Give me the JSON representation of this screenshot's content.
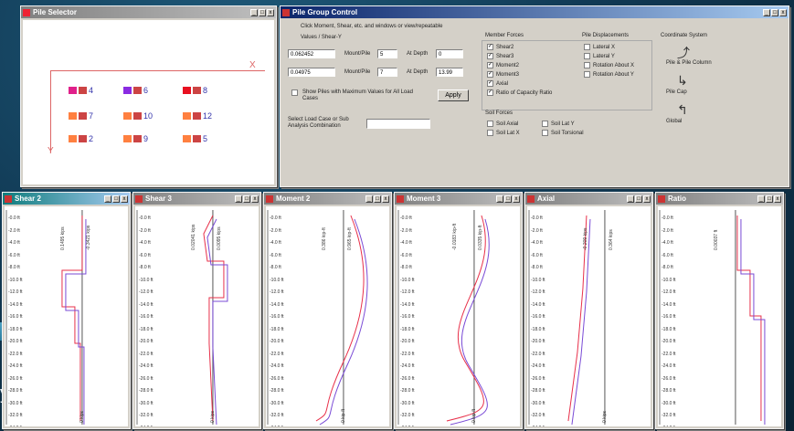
{
  "slide": {
    "text": "y"
  },
  "pile_selector": {
    "title": "Pile Selector",
    "axis_x": "X",
    "axis_y": "Y",
    "piles": [
      {
        "label": "4",
        "color": "#e0208a"
      },
      {
        "label": "6",
        "color": "#8a2be2"
      },
      {
        "label": "8",
        "color": "#e81020"
      },
      {
        "label": "7",
        "color": "#ff8040"
      },
      {
        "label": "10",
        "color": "#ff8040"
      },
      {
        "label": "12",
        "color": "#ff8040"
      },
      {
        "label": "2",
        "color": "#ff8040"
      },
      {
        "label": "9",
        "color": "#ff8040"
      },
      {
        "label": "5",
        "color": "#ff8040"
      }
    ]
  },
  "pile_group_control": {
    "title": "Pile Group Control",
    "instruction": "Click Moment, Shear, etc. and windows or view/repeatable",
    "values_label": "Values / Shear-Y",
    "value_1": "0.062452",
    "value_2": "0.04975",
    "at_pile_label": "Mount/Pile",
    "at_pile_1": "5",
    "at_pile_2": "7",
    "at_depth_label": "At Depth",
    "at_depth_1": "0",
    "at_depth_2": "13.99",
    "show_piles_label": "Show Piles with Maximum Values for All Load Cases",
    "apply_label": "Apply",
    "select_load_label": "Select Load Case or Sub Analysis Combination",
    "member_forces_title": "Member Forces",
    "member_forces": [
      {
        "label": "Shear2",
        "checked": true
      },
      {
        "label": "Shear3",
        "checked": true
      },
      {
        "label": "Moment2",
        "checked": true
      },
      {
        "label": "Moment3",
        "checked": true
      },
      {
        "label": "Axial",
        "checked": true
      },
      {
        "label": "Ratio of Capacity Ratio",
        "checked": true
      }
    ],
    "soil_forces_title": "Soil Forces",
    "soil_forces": [
      {
        "label": "Soil Axial",
        "checked": false
      },
      {
        "label": "Soil Lat X",
        "checked": false
      },
      {
        "label": "Soil Lat Y",
        "checked": false
      },
      {
        "label": "Soil Torsional",
        "checked": false
      }
    ],
    "pile_displacements_title": "Pile Displacements",
    "pile_displacements": [
      {
        "label": "Lateral X",
        "checked": false
      },
      {
        "label": "Lateral Y",
        "checked": false
      },
      {
        "label": "Rotation About X",
        "checked": false
      },
      {
        "label": "Rotation About Y",
        "checked": false
      }
    ],
    "coordinate_title": "Coordinate System",
    "coordinates": [
      {
        "label": "Pile & Pile Column"
      },
      {
        "label": "Pile Cap"
      },
      {
        "label": "Global"
      }
    ]
  },
  "plot_windows": [
    {
      "title": "Shear 2",
      "max_label": "0.1495 kips",
      "min_label": "-0.3421 kips",
      "bottom_label": "0 kips",
      "active": true
    },
    {
      "title": "Shear 3",
      "max_label": "0.02041 kips",
      "min_label": "0.0095 kips",
      "bottom_label": "0 kips",
      "active": false
    },
    {
      "title": "Moment 2",
      "max_label": "0.386 kip-ft",
      "min_label": "0.965 kip-ft",
      "bottom_label": "0 kip-ft",
      "active": false
    },
    {
      "title": "Moment 3",
      "max_label": "-0.0183 kip-ft",
      "min_label": "0.0335 kip-ft",
      "bottom_label": "0 kip-ft",
      "active": false
    },
    {
      "title": "Axial",
      "max_label": "-0.209 kips",
      "min_label": "0.364 kips",
      "bottom_label": "0 kips",
      "active": false
    },
    {
      "title": "Ratio",
      "max_label": "0.00037 ft",
      "min_label": "",
      "bottom_label": "",
      "active": false
    }
  ],
  "depth_ticks": [
    "-0.0 ft",
    "-2.0 ft",
    "-4.0 ft",
    "-6.0 ft",
    "-8.0 ft",
    "-10.0 ft",
    "-12.0 ft",
    "-14.0 ft",
    "-16.0 ft",
    "-18.0 ft",
    "-20.0 ft",
    "-22.0 ft",
    "-24.0 ft",
    "-26.0 ft",
    "-28.0 ft",
    "-30.0 ft",
    "-32.0 ft",
    "-34.0 ft"
  ],
  "colors": {
    "series_a": "#e8304a",
    "series_b": "#7a4bd6"
  }
}
